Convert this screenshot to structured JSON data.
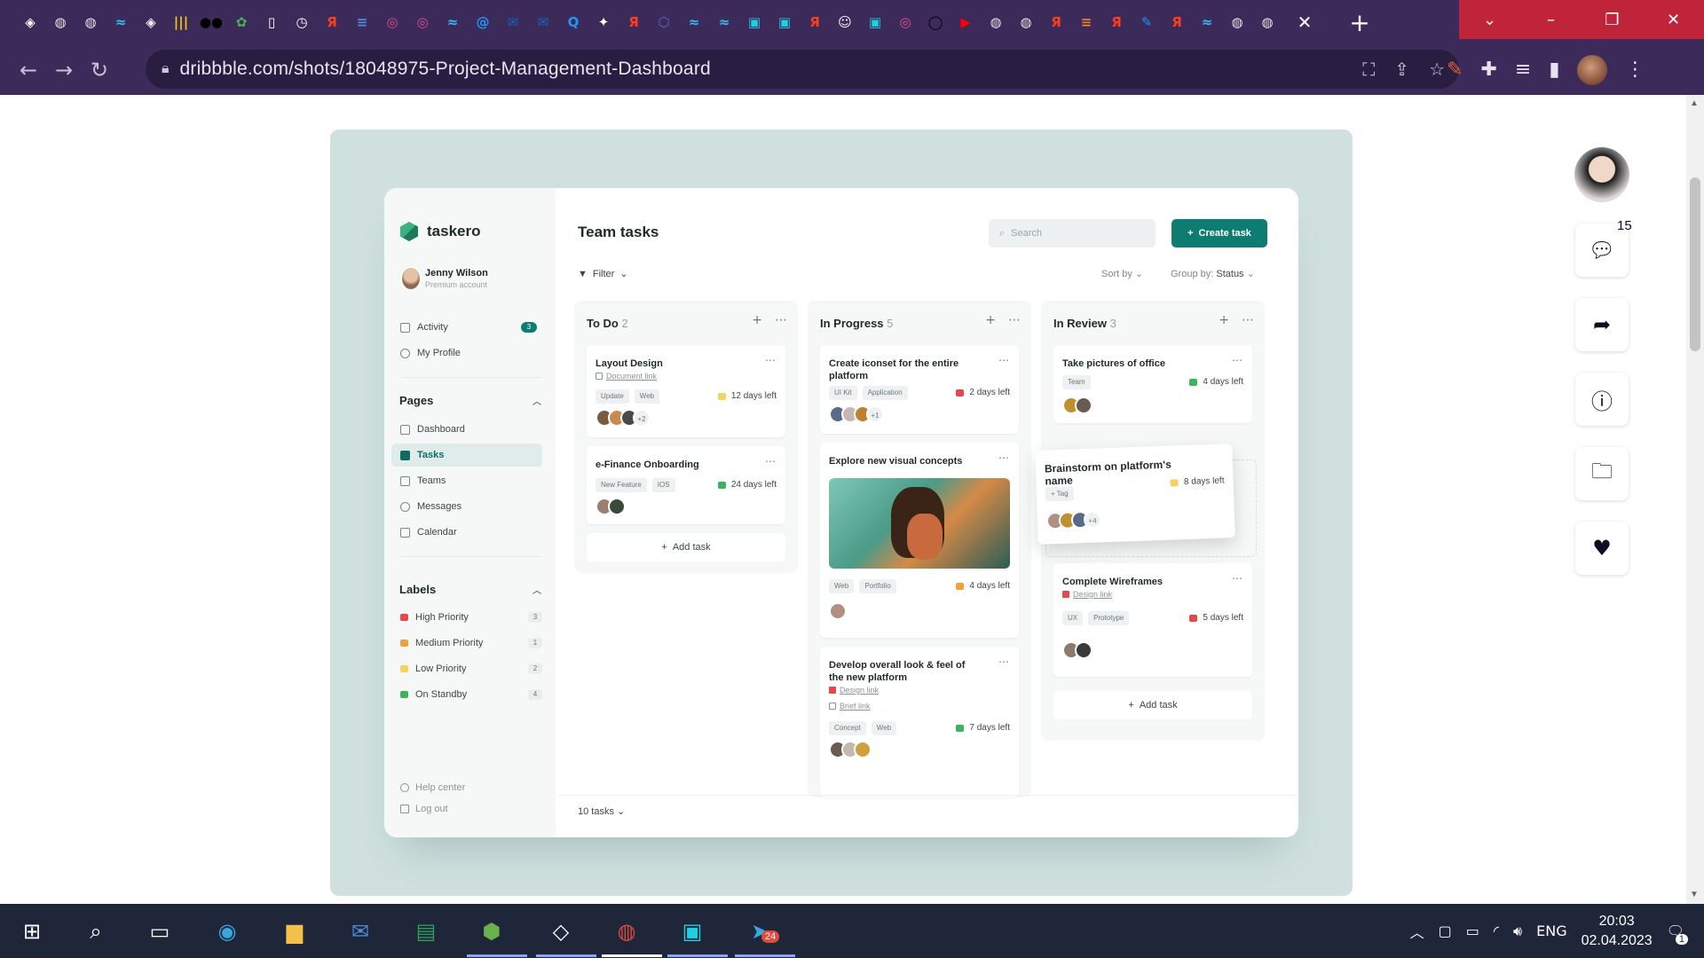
{
  "browser": {
    "url": "dribbble.com/shots/18048975-Project-Management-Dashboard",
    "tab_icons": [
      "codepen",
      "chrome",
      "chrome",
      "tailwind",
      "codepen",
      "bars",
      "medium",
      "leaf",
      "doc",
      "clock",
      "yandex",
      "stack",
      "dribbble",
      "dribbble",
      "tailwind",
      "at",
      "mail",
      "mail",
      "q",
      "star",
      "yandex",
      "cube",
      "tailwind",
      "tailwind",
      "ws",
      "ws",
      "yandex",
      "smile",
      "ws",
      "dribbble",
      "github",
      "youtube",
      "chrome",
      "chrome",
      "yandex",
      "stackoverflow",
      "yandex",
      "pen",
      "yandex",
      "tailwind",
      "chrome",
      "chrome"
    ],
    "close_glyph": "✕",
    "new_tab_glyph": "+"
  },
  "app": {
    "brand": "taskero",
    "user_name": "Jenny Wilson",
    "user_role": "Premium account",
    "nav_top": [
      {
        "label": "Activity",
        "count": "3"
      },
      {
        "label": "My Profile"
      }
    ],
    "pages_title": "Pages",
    "pages": [
      "Dashboard",
      "Tasks",
      "Teams",
      "Messages",
      "Calendar"
    ],
    "labels_title": "Labels",
    "labels": [
      {
        "label": "High Priority",
        "count": "3",
        "color": "#e5484d"
      },
      {
        "label": "Medium Priority",
        "count": "1",
        "color": "#f0a13a"
      },
      {
        "label": "Low Priority",
        "count": "2",
        "color": "#f5d25c"
      },
      {
        "label": "On Standby",
        "count": "4",
        "color": "#3bb55b"
      }
    ],
    "help": "Help center",
    "logout": "Log out",
    "title": "Team tasks",
    "search_placeholder": "Search",
    "create": "Create task",
    "filter": "Filter",
    "sort_by": "Sort by",
    "group_by_label": "Group by:",
    "group_by_value": "Status",
    "footer_tasks": "10 tasks",
    "add_task": "Add task",
    "columns": [
      {
        "title": "To Do",
        "count": "2"
      },
      {
        "title": "In Progress",
        "count": "5"
      },
      {
        "title": "In Review",
        "count": "3"
      }
    ],
    "cards": {
      "todo1": {
        "title": "Layout Design",
        "link": "Document link",
        "tags": [
          "Update",
          "Web"
        ],
        "due": "12 days left",
        "more": "+2"
      },
      "todo2": {
        "title": "e-Finance Onboarding",
        "tags": [
          "New Feature",
          "IOS"
        ],
        "due": "24 days left"
      },
      "prog1": {
        "title": "Create iconset for the entire platform",
        "tags": [
          "UI Kit",
          "Application"
        ],
        "due": "2 days left",
        "more": "+1"
      },
      "prog2": {
        "title": "Explore new visual concepts",
        "tags": [
          "Web",
          "Portfolio"
        ],
        "due": "4 days left"
      },
      "prog3": {
        "title": "Develop overall look & feel of the new platform",
        "link1": "Design link",
        "link2": "Brief link",
        "tags": [
          "Concept",
          "Web"
        ],
        "due": "7 days left"
      },
      "rev1": {
        "title": "Take pictures of office",
        "tags": [
          "Team"
        ],
        "due": "4 days left"
      },
      "drag": {
        "title": "Brainstorm on platform's name",
        "tag": "Tag",
        "due": "8 days left",
        "more": "+4"
      },
      "rev3": {
        "title": "Complete Wireframes",
        "link": "Design link",
        "tags": [
          "UX",
          "Prototype"
        ],
        "due": "5 days left"
      }
    }
  },
  "dribbble": {
    "comments": "15"
  },
  "taskbar": {
    "lang": "ENG",
    "time": "20:03",
    "date": "02.04.2023",
    "notif": "1",
    "telegram_badge": "24"
  }
}
